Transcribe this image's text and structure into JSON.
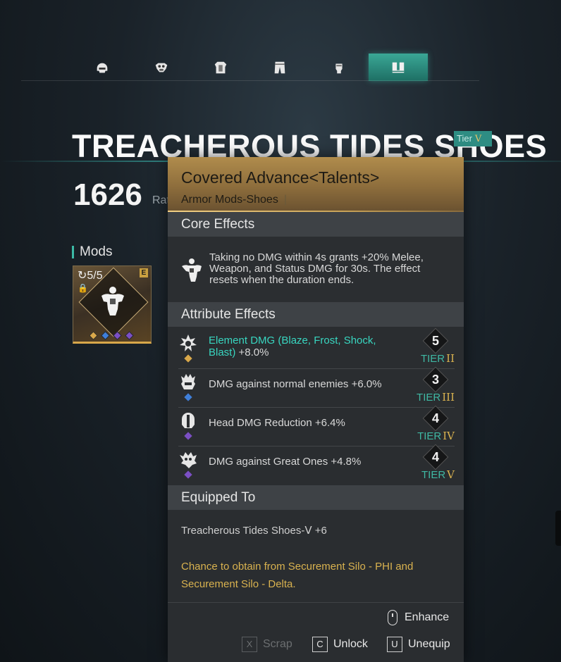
{
  "tabs": [
    {
      "icon": "helmet-icon",
      "active": false
    },
    {
      "icon": "mask-icon",
      "active": false
    },
    {
      "icon": "armor-top-icon",
      "active": false
    },
    {
      "icon": "pants-icon",
      "active": false
    },
    {
      "icon": "gloves-icon",
      "active": false
    },
    {
      "icon": "shoes-icon",
      "active": true
    }
  ],
  "item": {
    "title": "TREACHEROUS TIDES SHOES",
    "tier_label": "Tier",
    "tier_roman": "V",
    "rating_value": "1626",
    "rating_label": "Rati"
  },
  "mods": {
    "heading": "Mods",
    "slot": {
      "count": "5/5",
      "grade": "E"
    }
  },
  "tooltip": {
    "name": "Covered Advance<Talents>",
    "subtitle": "Armor Mods-Shoes",
    "subtitle_sep": "|",
    "core_heading": "Core Effects",
    "core_text": "Taking no DMG within 4s grants +20% Melee, Weapon, and Status DMG for 30s. The effect resets when the duration ends.",
    "attr_heading": "Attribute Effects",
    "attributes": [
      {
        "highlight": "Element DMG (Blaze, Frost, Shock, Blast)",
        "text": " +8.0%",
        "level": "5",
        "tier_word": "TIER",
        "tier_roman": "II",
        "pip": "#d9a84a",
        "roman_color": "#d9b24f"
      },
      {
        "highlight": "",
        "text": "DMG against normal enemies +6.0%",
        "level": "3",
        "tier_word": "TIER",
        "tier_roman": "III",
        "pip": "#3f7fd9",
        "roman_color": "#d9b24f"
      },
      {
        "highlight": "",
        "text": "Head DMG Reduction +6.4%",
        "level": "4",
        "tier_word": "TIER",
        "tier_roman": "IV",
        "pip": "#7b4fc4",
        "roman_color": "#d9b24f"
      },
      {
        "highlight": "",
        "text": "DMG against Great Ones +4.8%",
        "level": "4",
        "tier_word": "TIER",
        "tier_roman": "V",
        "pip": "#7b4fc4",
        "roman_color": "#d9b24f"
      }
    ],
    "equipped_heading": "Equipped To",
    "equipped_item": "Treacherous Tides Shoes-Ⅴ +6",
    "source_text": "Chance to obtain from Securement Silo - PHI and Securement Silo - Delta."
  },
  "actions": {
    "enhance": "Enhance",
    "scrap_key": "X",
    "scrap": "Scrap",
    "unlock_key": "C",
    "unlock": "Unlock",
    "unequip_key": "U",
    "unequip": "Unequip"
  },
  "colors": {
    "accent": "#3bb9a6",
    "gold": "#d9b24f",
    "highlight": "#38d6c0"
  }
}
